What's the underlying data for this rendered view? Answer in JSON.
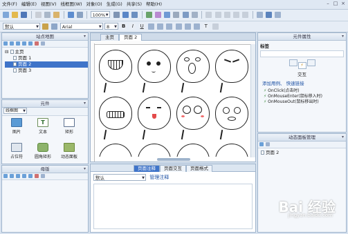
{
  "menu": [
    "文件(F)",
    "编辑(E)",
    "视图(V)",
    "线框图(W)",
    "对象(O)",
    "生成(G)",
    "共享(S)",
    "帮助(H)"
  ],
  "toolbar": {
    "zoom": "100%",
    "style": "默认",
    "font": "Arial",
    "font_size": "8"
  },
  "sitemap": {
    "title": "站点地图",
    "items": [
      {
        "label": "主页"
      },
      {
        "label": "页面 1"
      },
      {
        "label": "页面 2"
      },
      {
        "label": "页面 3"
      }
    ]
  },
  "widgets": {
    "title": "元件",
    "selector": "线框图",
    "items": [
      {
        "label": "图片"
      },
      {
        "label": "文本"
      },
      {
        "label": "矩形"
      },
      {
        "label": "占位符"
      },
      {
        "label": "圆角矩形"
      },
      {
        "label": "动态面板"
      }
    ]
  },
  "masters": {
    "title": "母版"
  },
  "canvas": {
    "tabs": [
      "主页",
      "页面 2"
    ]
  },
  "page_notes": {
    "tabs": [
      "页面注释",
      "页面交互",
      "页面格式"
    ],
    "style_select": "默认",
    "manage_link": "管理注释"
  },
  "props": {
    "title": "元件属性",
    "label_caption": "标签",
    "section": "交互",
    "add_case": "添加用例、 快速链接",
    "events": [
      "OnClick(点击时)",
      "OnMouseEnter(鼠标移入时)",
      "OnMouseOut(鼠标移出时)"
    ]
  },
  "dyn_panel": {
    "title": "动态面板管理",
    "item": "页面 2"
  },
  "watermark": {
    "brand": "Bai 经验",
    "url": "jingyan.baidu.com"
  }
}
